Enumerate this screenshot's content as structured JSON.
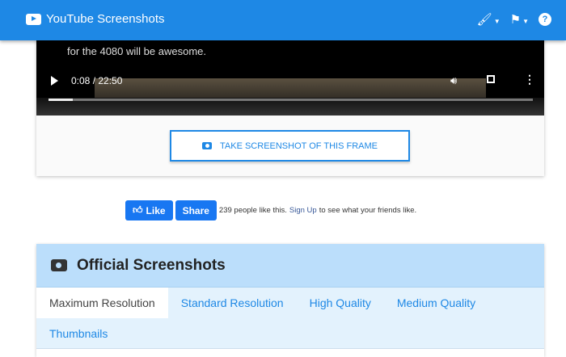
{
  "header": {
    "title": "YouTube Screenshots",
    "icons": [
      "paint-brush-icon",
      "flag-icon",
      "help-icon"
    ]
  },
  "video": {
    "caption": "for the 4080 will be awesome.",
    "time": "0:08 / 22:50",
    "progress": 0.05
  },
  "screenshot_button": {
    "label": "TAKE SCREENSHOT OF THIS FRAME"
  },
  "facebook": {
    "like": "Like",
    "share": "Share",
    "count_text": "239 people like this.",
    "signup": "Sign Up",
    "suffix": "to see what your friends like."
  },
  "panel": {
    "title": "Official Screenshots",
    "tabs": [
      "Maximum Resolution",
      "Standard Resolution",
      "High Quality",
      "Medium Quality",
      "Thumbnails"
    ]
  }
}
